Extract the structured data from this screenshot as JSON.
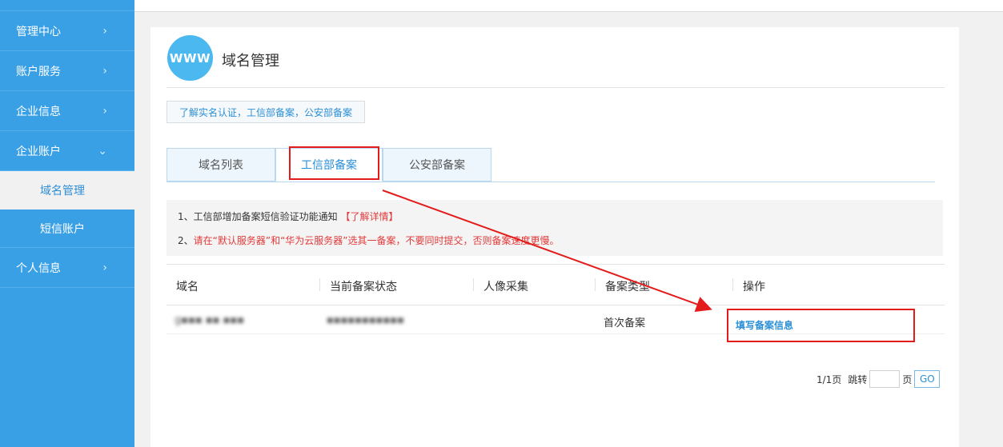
{
  "sidebar": {
    "items": [
      {
        "label": "管理中心",
        "chevron": "›"
      },
      {
        "label": "账户服务",
        "chevron": "›"
      },
      {
        "label": "企业信息",
        "chevron": "›"
      },
      {
        "label": "企业账户",
        "chevron": "⌄"
      }
    ],
    "sub_items": [
      {
        "label": "域名管理",
        "active": true
      },
      {
        "label": "短信账户",
        "active": false
      }
    ],
    "personal": {
      "label": "个人信息",
      "chevron": "›"
    }
  },
  "page": {
    "logo_text": "WWW",
    "title": "域名管理",
    "notice_link": "了解实名认证，工信部备案，公安部备案"
  },
  "tabs": [
    {
      "label": "域名列表",
      "active": false
    },
    {
      "label": "工信部备案",
      "active": true
    },
    {
      "label": "公安部备案",
      "active": false
    }
  ],
  "info": {
    "line1_prefix": "1、工信部增加备案短信验证功能通知",
    "line1_link": "【了解详情】",
    "line2_num": "2、",
    "line2_text": "请在“默认服务器”和“华为云服务器”选其一备案，不要同时提交，否则备案速度更慢。"
  },
  "table": {
    "headers": [
      "域名",
      "当前备案状态",
      "人像采集",
      "备案类型",
      "操作"
    ],
    "rows": [
      {
        "domain": "g▪▪▪ ▪▪ ▪▪▪",
        "status": "▪▪▪▪▪▪▪▪▪▪▪",
        "portrait": "",
        "type": "首次备案",
        "action": "填写备案信息"
      }
    ]
  },
  "pager": {
    "pages": "1/1页",
    "jump_label": "跳转",
    "page_unit": "页",
    "go_label": "GO"
  },
  "colors": {
    "sidebar_bg": "#3aa0e6",
    "link_blue": "#2b8fd6",
    "annotation_red": "#e31b1b",
    "warning_red": "#e23a3a"
  }
}
